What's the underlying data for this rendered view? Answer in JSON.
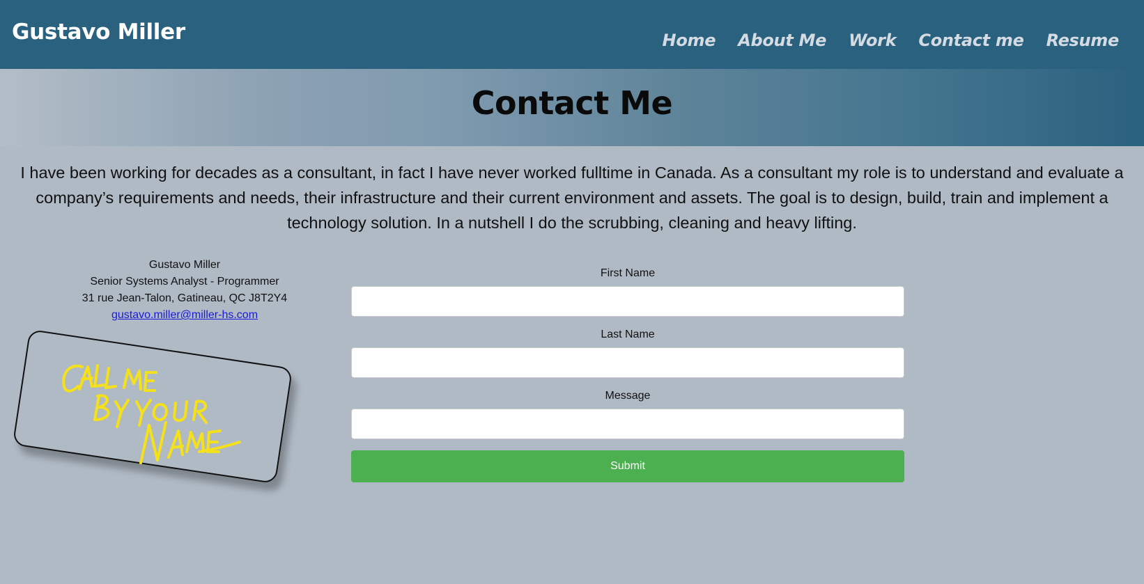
{
  "header": {
    "brand": "Gustavo Miller",
    "nav": [
      "Home",
      "About Me",
      "Work",
      "Contact me",
      "Resume"
    ]
  },
  "hero": {
    "title": "Contact Me"
  },
  "intro": "I have been working for decades as a consultant, in fact I have never worked fulltime in Canada. As a consultant my role is to understand and evaluate a company’s requirements and needs, their infrastructure and their current environment and assets. The goal is to design, build, train and implement a technology solution. In a nutshell I do the scrubbing, cleaning and heavy lifting.",
  "contact_card": {
    "name": "Gustavo Miller",
    "title": "Senior Systems Analyst - Programmer",
    "address": "31 rue Jean-Talon, Gatineau, QC J8T2Y4",
    "email": "gustavo.miller@miller-hs.com",
    "sign_text": "CALL ME BY YOUR NAME"
  },
  "form": {
    "first_name_label": "First Name",
    "first_name_value": "",
    "last_name_label": "Last Name",
    "last_name_value": "",
    "message_label": "Message",
    "message_value": "",
    "submit_label": "Submit"
  },
  "colors": {
    "header_bg": "#2a617e",
    "page_bg": "#b0bac5",
    "submit_bg": "#4caf50",
    "sign_yellow": "#f5e01c"
  }
}
